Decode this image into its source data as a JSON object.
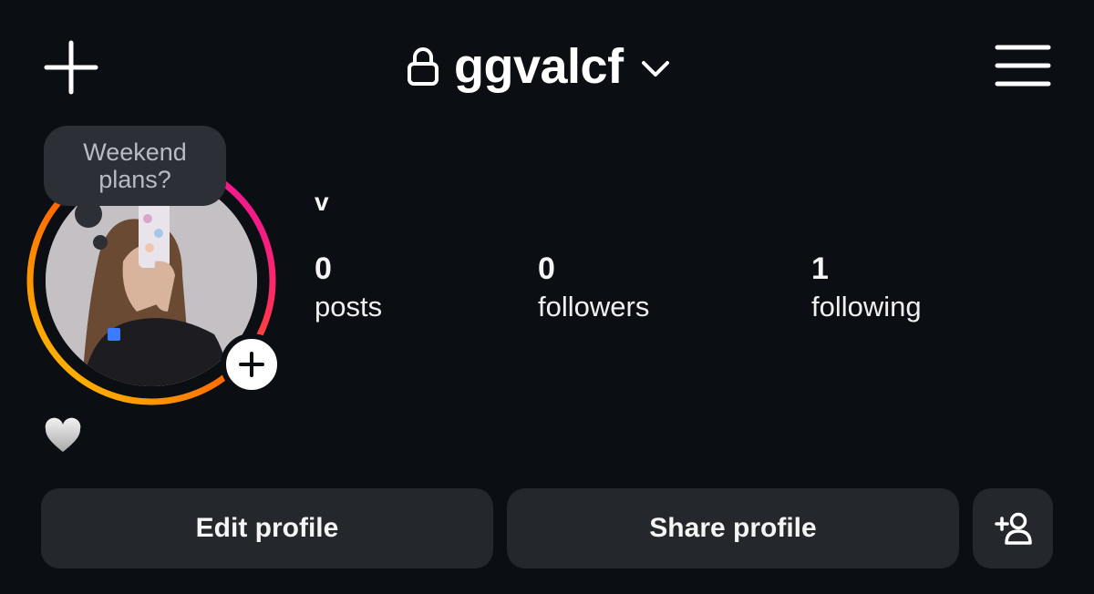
{
  "header": {
    "username": "ggvalcf",
    "icons": {
      "create": "plus-icon",
      "lock": "lock-icon",
      "switch": "chevron-down-icon",
      "menu": "hamburger-menu-icon"
    }
  },
  "profile": {
    "note": "Weekend plans?",
    "display_name": "v",
    "bio_icon": "white-heart-emoji",
    "story_ring_colors": [
      "#ff9f0a",
      "#ff3a5c",
      "#e60ab4"
    ],
    "stats": [
      {
        "count": "0",
        "label": "posts"
      },
      {
        "count": "0",
        "label": "followers"
      },
      {
        "count": "1",
        "label": "following"
      }
    ]
  },
  "actions": {
    "edit_label": "Edit profile",
    "share_label": "Share profile",
    "discover_icon": "add-person-icon"
  }
}
